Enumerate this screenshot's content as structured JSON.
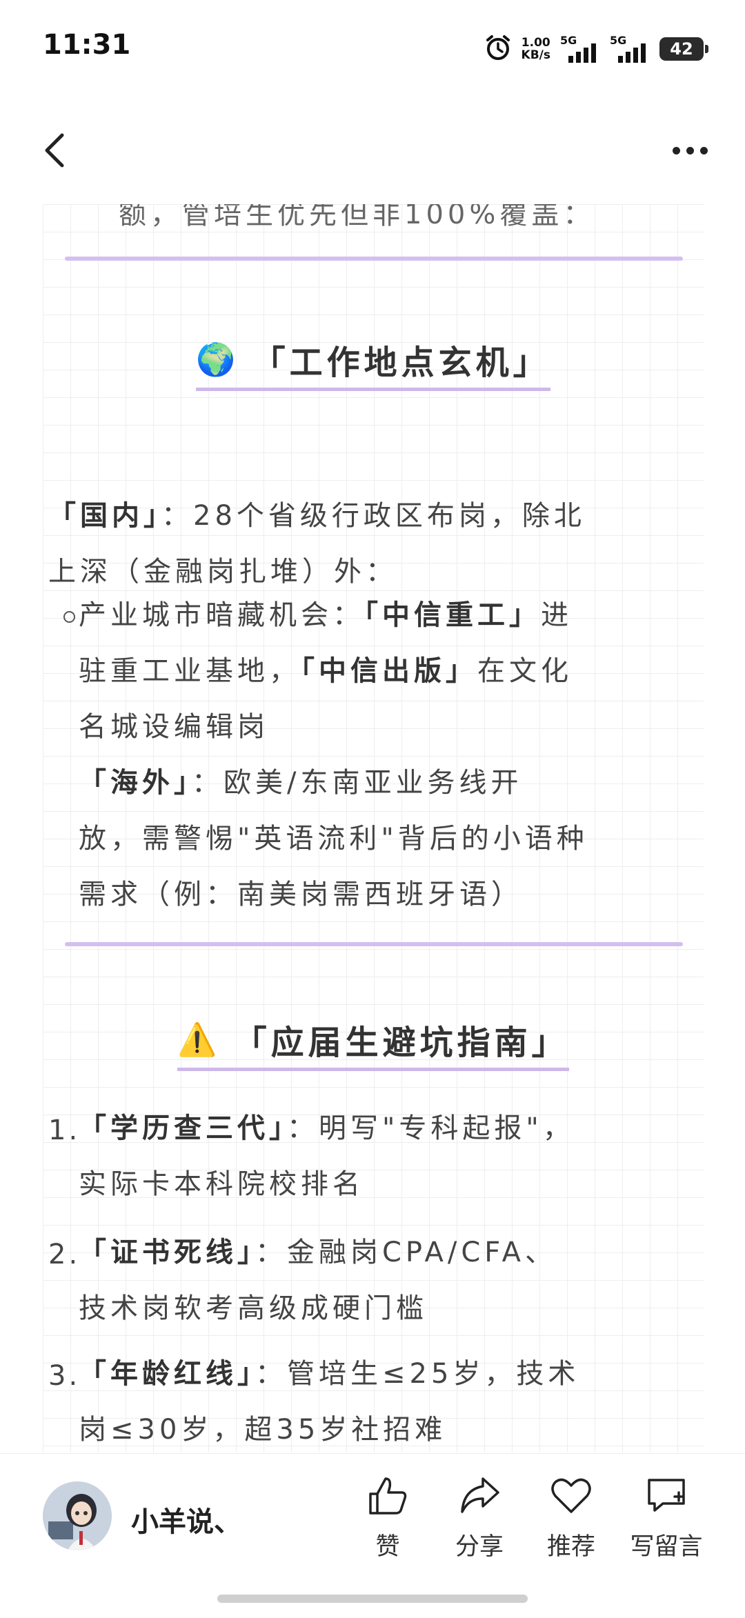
{
  "status_bar": {
    "time": "11:31",
    "speed_value": "1.00",
    "speed_unit": "KB/s",
    "signal1_label": "5G",
    "signal2_label": "5G",
    "battery_level": "42"
  },
  "article": {
    "cut_line": "额，管培生优先但非100%覆盖：",
    "section1": {
      "emoji": "🌍",
      "title": "「工作地点玄机」"
    },
    "domestic_label": "「国内」",
    "domestic_text_1": "：28个省级行政区布岗，除北",
    "domestic_text_2": "上深（金融岗扎堆）外：",
    "bullet": {
      "prefix": "产业城市暗藏机会：",
      "citic_heavy": "「中信重工」",
      "citic_heavy_suffix": "进",
      "line2_a": "驻重工业基地，",
      "citic_press": "「中信出版」",
      "line2_b": "在文化",
      "line3": "名城设编辑岗"
    },
    "overseas_label": "「海外」",
    "overseas_text_1": "：欧美/东南亚业务线开",
    "overseas_text_2": "放，需警惕\"英语流利\"背后的小语种",
    "overseas_text_3": "需求（例：南美岗需西班牙语）",
    "section2": {
      "emoji": "⚠️",
      "title": "「应届生避坑指南」"
    },
    "list": [
      {
        "num": "1.",
        "label": "「学历查三代」",
        "text_1": "：明写\"专科起报\"，",
        "text_2": "实际卡本科院校排名"
      },
      {
        "num": "2.",
        "label": "「证书死线」",
        "text_1": "：金融岗CPA/CFA、",
        "text_2": "技术岗软考高级成硬门槛"
      },
      {
        "num": "3.",
        "label": "「年龄红线」",
        "text_1": "：管培生≤25岁，技术",
        "text_2": "岗≤30岁，超35岁社招难"
      }
    ]
  },
  "bottom_bar": {
    "author_name": "小羊说、",
    "like_label": "赞",
    "share_label": "分享",
    "recommend_label": "推荐",
    "comment_label": "写留言"
  },
  "colors": {
    "divider": "#d3bfef",
    "grid": "#eeeeee",
    "text": "#3a3a3a"
  },
  "icons": [
    "back-arrow-icon",
    "more-dots-icon",
    "thumbs-up-icon",
    "share-icon",
    "heart-icon",
    "comment-icon",
    "alarm-clock-icon"
  ]
}
